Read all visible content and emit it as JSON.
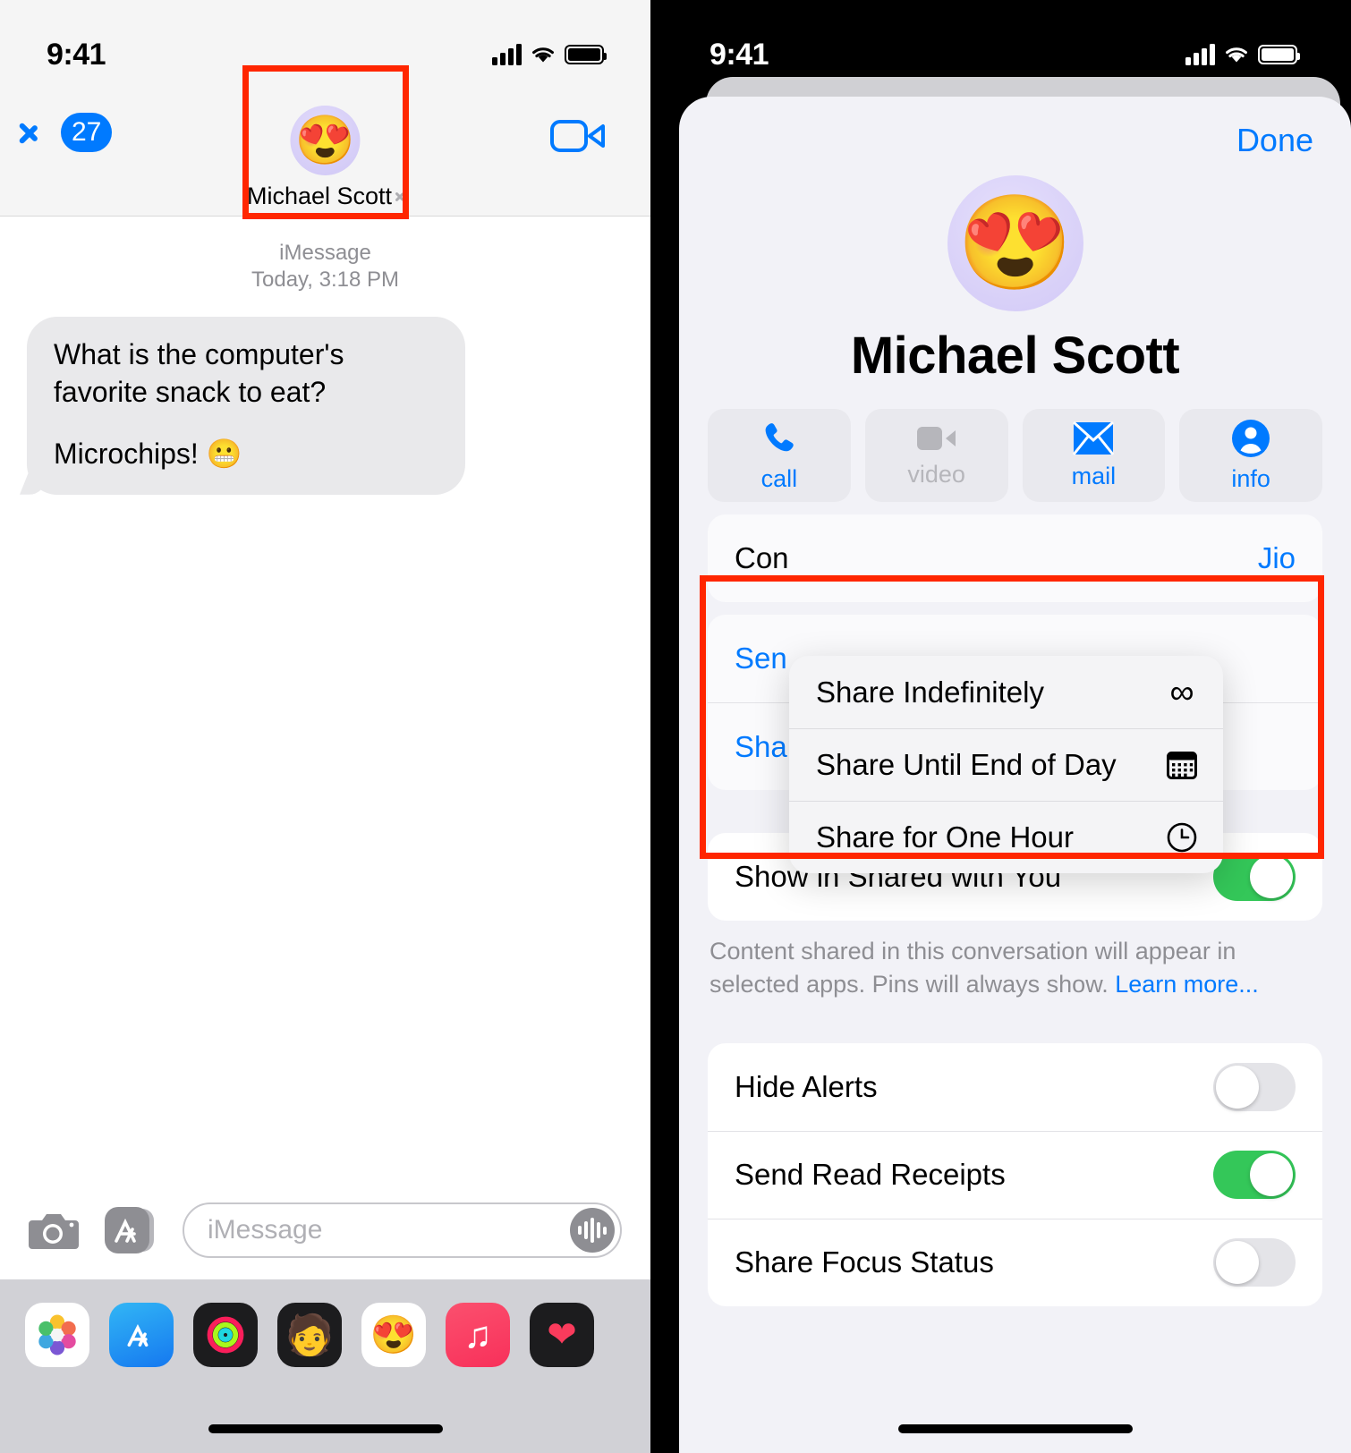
{
  "left_phone": {
    "status_bar": {
      "time": "9:41",
      "cellular_icon": "signal-bars-icon",
      "wifi_icon": "wifi-icon",
      "battery_icon": "battery-full-icon"
    },
    "nav_bar": {
      "back_icon": "chevron-left-icon",
      "unread_count": "27",
      "contact_name": "Michael Scott",
      "disclosure_icon": "chevron-right-icon",
      "avatar_emoji": "😍",
      "facetime_icon": "video-camera-icon"
    },
    "thread": {
      "service": "iMessage",
      "timestamp": "Today, 3:18 PM",
      "messages": [
        {
          "line1": "What is the computer's favorite snack to eat?",
          "line2": "Microchips! 😬"
        }
      ]
    },
    "input_bar": {
      "camera_icon": "camera-icon",
      "apps_icon": "app-store-icon",
      "placeholder": "iMessage",
      "mic_icon": "audio-waveform-icon"
    },
    "app_drawer": [
      {
        "name": "photos-app-icon",
        "glyph": "🌸"
      },
      {
        "name": "app-store-app-icon",
        "glyph": "A"
      },
      {
        "name": "fitness-app-icon",
        "glyph": "◎"
      },
      {
        "name": "memoji-app-icon",
        "glyph": "🧑"
      },
      {
        "name": "stickers-app-icon",
        "glyph": "😍"
      },
      {
        "name": "music-app-icon",
        "glyph": "♫"
      },
      {
        "name": "digital-touch-app-icon",
        "glyph": "❤"
      }
    ]
  },
  "right_phone": {
    "status_bar": {
      "time": "9:41",
      "cellular_icon": "signal-bars-icon",
      "wifi_icon": "wifi-icon",
      "battery_icon": "battery-full-icon"
    },
    "sheet": {
      "done_label": "Done",
      "avatar_emoji": "😍",
      "contact_name": "Michael Scott",
      "actions": [
        {
          "label": "call",
          "icon": "phone-icon",
          "enabled": true
        },
        {
          "label": "video",
          "icon": "video-camera-icon",
          "enabled": false
        },
        {
          "label": "mail",
          "icon": "envelope-icon",
          "enabled": true
        },
        {
          "label": "info",
          "icon": "contact-info-icon",
          "enabled": true
        }
      ],
      "obscured_rows": [
        {
          "label": "Con",
          "value": "Jio"
        },
        {
          "label": "Sen",
          "value": ""
        }
      ],
      "share_location_label": "Share My Location",
      "shared_with_you": {
        "label": "Show in Shared with You",
        "toggle_state": "on",
        "footnote_text": "Content shared in this conversation will appear in selected apps. Pins will always show. ",
        "footnote_link": "Learn more..."
      },
      "settings": [
        {
          "label": "Hide Alerts",
          "toggle_state": "off"
        },
        {
          "label": "Send Read Receipts",
          "toggle_state": "on"
        },
        {
          "label": "Share Focus Status",
          "toggle_state": "off"
        }
      ]
    },
    "context_menu": {
      "items": [
        {
          "label": "Share Indefinitely",
          "icon": "infinity-icon",
          "glyph": "∞"
        },
        {
          "label": "Share Until End of Day",
          "icon": "calendar-icon",
          "glyph": ""
        },
        {
          "label": "Share for One Hour",
          "icon": "clock-icon",
          "glyph": ""
        }
      ]
    }
  },
  "annotations": {
    "accent_color": "#ff2600",
    "highlight_1": "contact-header-highlight",
    "highlight_2": "share-location-menu-highlight"
  }
}
